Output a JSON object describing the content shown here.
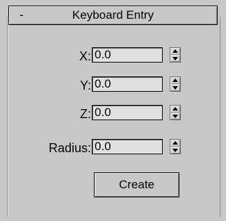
{
  "rollout": {
    "toggle": "-",
    "title": "Keyboard Entry"
  },
  "fields": [
    {
      "label": "X:",
      "value": "0.0"
    },
    {
      "label": "Y:",
      "value": "0.0"
    },
    {
      "label": "Z:",
      "value": "0.0"
    },
    {
      "label": "Radius:",
      "value": "0.0"
    }
  ],
  "create_label": "Create"
}
